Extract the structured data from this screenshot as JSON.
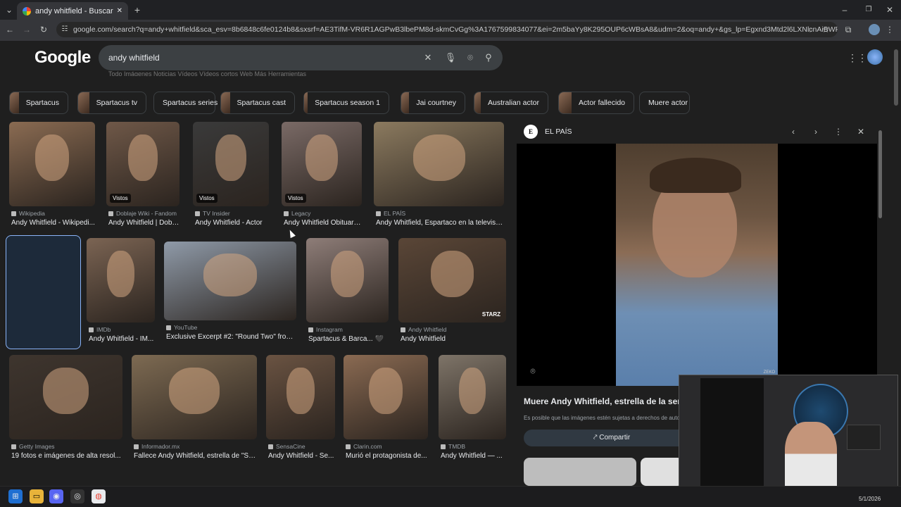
{
  "browser": {
    "tab_title": "andy whitfield - Buscar con Goo",
    "url": "google.com/search?q=andy+whitfield&sca_esv=8b6848c6fe0124b8&sxsrf=AE3TifM-VR6R1AGPwB3lbePM8d-skmCvGg%3A1767599834077&ei=2m5baYy8K295OUP6cWBsA8&udm=2&oq=andy+&gs_lp=Egxnd3Mtd2l6LXNlcnAiBWFuZHkgKglIADI..."
  },
  "google": {
    "logo": "Google",
    "query": "andy whitfield",
    "nav_hint": "Todo        Imágenes        Noticias        Vídeos        Vídeos cortos        Web        Más                          Herramientas"
  },
  "chips": [
    {
      "label": "Spartacus",
      "thumb": true
    },
    {
      "label": "Spartacus tv",
      "thumb": true
    },
    {
      "label": "Spartacus series",
      "thumb": false
    },
    {
      "label": "Spartacus cast",
      "thumb": true
    },
    {
      "label": "Spartacus season 1",
      "thumb": true
    },
    {
      "label": "Jai courtney",
      "thumb": true
    },
    {
      "label": "Australian actor",
      "thumb": true
    },
    {
      "label": "Actor fallecido",
      "thumb": true
    },
    {
      "label": "Muere actor",
      "thumb": false
    }
  ],
  "results": [
    {
      "source": "Wikipedia",
      "title": "Andy Whitfield - Wikipedi...",
      "badge": "",
      "color": "#8a6b52"
    },
    {
      "source": "Doblaje Wiki - Fandom",
      "title": "Andy Whitfield | Dobla...",
      "badge": "Vistos",
      "color": "#6f5848"
    },
    {
      "source": "TV Insider",
      "title": "Andy Whitfield - Actor",
      "badge": "Vistos",
      "color": "#3a3a3a"
    },
    {
      "source": "Legacy",
      "title": "Andy Whitfield Obituary...",
      "badge": "Vistos",
      "color": "#7a6a66"
    },
    {
      "source": "EL PAÍS",
      "title": "Andy Whitfield, Espartaco en la televisió...",
      "badge": "",
      "color": "#8b7a5f"
    },
    {
      "source": "EL PAÍS",
      "title": "Muere Andy Whitfi...",
      "badge": "",
      "color": "#6f7f9e"
    },
    {
      "source": "IMDb",
      "title": "Andy Whitfield - IM...",
      "badge": "",
      "color": "#7b6453"
    },
    {
      "source": "YouTube",
      "title": "Exclusive Excerpt #2: \"Round Two\" from...",
      "badge": "",
      "color": "#8f9aa8"
    },
    {
      "source": "Instagram",
      "title": "Spartacus & Barca... 🖤",
      "badge": "",
      "color": "#8e7d78"
    },
    {
      "source": "Andy Whitfield",
      "title": "Andy Whitfield",
      "badge": "STARZ",
      "color": "#5a4637"
    },
    {
      "source": "Getty Images",
      "title": "19 fotos e imágenes de alta resol...",
      "badge": "",
      "color": "#3e352e"
    },
    {
      "source": "Informador.mx",
      "title": "Fallece Andy Whitfield, estrella de \"Sp...",
      "badge": "",
      "color": "#7d6a52"
    },
    {
      "source": "SensaCine",
      "title": "Andy Whitfield - Se...",
      "badge": "",
      "color": "#6a5342"
    },
    {
      "source": "Clarin.com",
      "title": "Murió el protagonista de...",
      "badge": "",
      "color": "#8a6a52"
    },
    {
      "source": "TMDB",
      "title": "Andy Whitfield — ...",
      "badge": "",
      "color": "#7e7468"
    }
  ],
  "panel": {
    "source": "EL PAÍS",
    "logo_letter": "E",
    "title": "Muere Andy Whitfield, estrella de la serie",
    "note": "Es posible que las imágenes estén sujetas a derechos de autor.",
    "share_label": "Compartir",
    "watermark": "ZEKO"
  },
  "clock": "5/1/2026"
}
